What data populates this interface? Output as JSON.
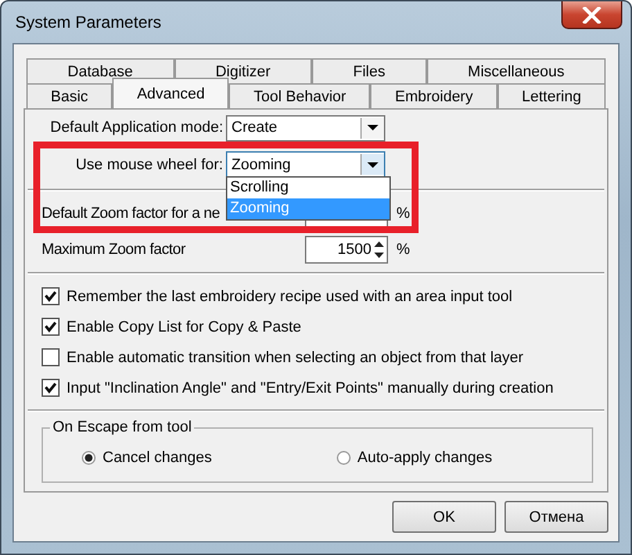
{
  "window": {
    "title": "System Parameters"
  },
  "tab_rows": [
    [
      {
        "label": "Database",
        "selected": false
      },
      {
        "label": "Digitizer",
        "selected": false
      },
      {
        "label": "Files",
        "selected": false
      },
      {
        "label": "Miscellaneous",
        "selected": false
      }
    ],
    [
      {
        "label": "Basic",
        "selected": false
      },
      {
        "label": "Advanced",
        "selected": true
      },
      {
        "label": "Tool Behavior",
        "selected": false
      },
      {
        "label": "Embroidery",
        "selected": false
      },
      {
        "label": "Lettering",
        "selected": false
      }
    ]
  ],
  "application_mode": {
    "label": "Default Application mode:",
    "value": "Create"
  },
  "mouse_wheel": {
    "label": "Use mouse wheel for:",
    "value": "Zooming",
    "expanded": true,
    "options": [
      {
        "label": "Scrolling",
        "selected": false
      },
      {
        "label": "Zooming",
        "selected": true
      }
    ]
  },
  "zoom_fields": [
    {
      "label": "Default Zoom factor for a ne",
      "unit": "%"
    },
    {
      "label": "Maximum Zoom factor",
      "value": "1500",
      "unit": "%"
    }
  ],
  "checkboxes": [
    {
      "label": "Remember the last embroidery recipe used with an area input tool",
      "checked": true
    },
    {
      "label": "Enable Copy List for Copy & Paste",
      "checked": true
    },
    {
      "label": "Enable automatic transition when selecting an object from that layer",
      "checked": false
    },
    {
      "label": "Input \"Inclination Angle\" and \"Entry/Exit Points\" manually during creation",
      "checked": true
    }
  ],
  "escape_group": {
    "title": "On Escape from tool",
    "options": [
      {
        "label": "Cancel changes",
        "selected": true
      },
      {
        "label": "Auto-apply changes",
        "selected": false
      }
    ]
  },
  "annotation": {
    "kind": "rectangle"
  },
  "buttons": [
    "OK",
    "Отмена"
  ]
}
